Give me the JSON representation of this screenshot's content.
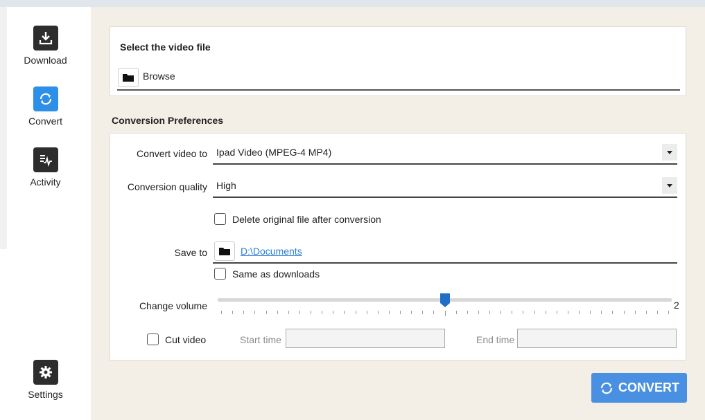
{
  "sidebar": {
    "items": [
      {
        "label": "Download",
        "icon": "download-icon"
      },
      {
        "label": "Convert",
        "icon": "convert-icon",
        "active": true
      },
      {
        "label": "Activity",
        "icon": "activity-icon"
      },
      {
        "label": "Settings",
        "icon": "gear-icon"
      }
    ]
  },
  "select_file": {
    "title": "Select the video file",
    "browse_label": "Browse"
  },
  "preferences": {
    "title": "Conversion Preferences",
    "convert_to_label": "Convert video to",
    "convert_to_value": "Ipad Video (MPEG-4 MP4)",
    "quality_label": "Conversion quality",
    "quality_value": "High",
    "delete_original_label": "Delete original file after conversion",
    "delete_original_checked": false,
    "save_to_label": "Save to",
    "save_to_path": "D:\\Documents",
    "same_as_downloads_label": "Same as downloads",
    "same_as_downloads_checked": false,
    "volume_label": "Change volume",
    "volume_value": "2",
    "volume_position": 0.5,
    "cut_video_label": "Cut video",
    "cut_video_checked": false,
    "start_time_label": "Start time",
    "end_time_label": "End time"
  },
  "convert_button": {
    "label": "CONVERT"
  },
  "colors": {
    "accent": "#4a90e2",
    "active_nav": "#2d8fe8",
    "link": "#2b7fd6"
  }
}
